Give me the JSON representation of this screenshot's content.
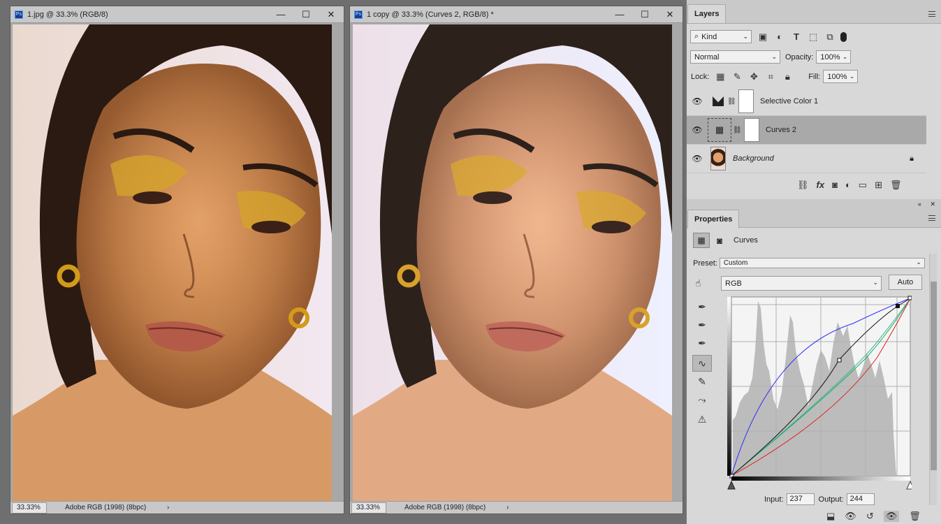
{
  "doc1": {
    "title": "1.jpg @ 33.3% (RGB/8)",
    "zoom": "33.33%",
    "profile": "Adobe RGB (1998) (8bpc)"
  },
  "doc2": {
    "title": "1 copy @ 33.3% (Curves 2, RGB/8) *",
    "zoom": "33.33%",
    "profile": "Adobe RGB (1998) (8bpc)"
  },
  "window_controls": {
    "minimize": "—",
    "maximize": "☐",
    "close": "✕"
  },
  "layers_panel": {
    "tab": "Layers",
    "kind_filter": "Kind",
    "blend_mode": "Normal",
    "opacity_label": "Opacity:",
    "opacity_value": "100%",
    "lock_label": "Lock:",
    "fill_label": "Fill:",
    "fill_value": "100%",
    "layers": [
      {
        "name": "Selective Color 1",
        "type": "adjustment",
        "selected": false
      },
      {
        "name": "Curves 2",
        "type": "adjustment",
        "selected": true
      },
      {
        "name": "Background",
        "type": "pixel",
        "selected": false,
        "locked": true
      }
    ]
  },
  "properties_panel": {
    "tab": "Properties",
    "adjustment_name": "Curves",
    "preset_label": "Preset:",
    "preset_value": "Custom",
    "channel": "RGB",
    "auto_label": "Auto",
    "input_label": "Input:",
    "input_value": "237",
    "output_label": "Output:",
    "output_value": "244"
  },
  "colors": {
    "accent_blue": "#2b2bff",
    "curve_green": "#12b04a",
    "curve_red": "#e02020",
    "curve_black": "#111111"
  }
}
